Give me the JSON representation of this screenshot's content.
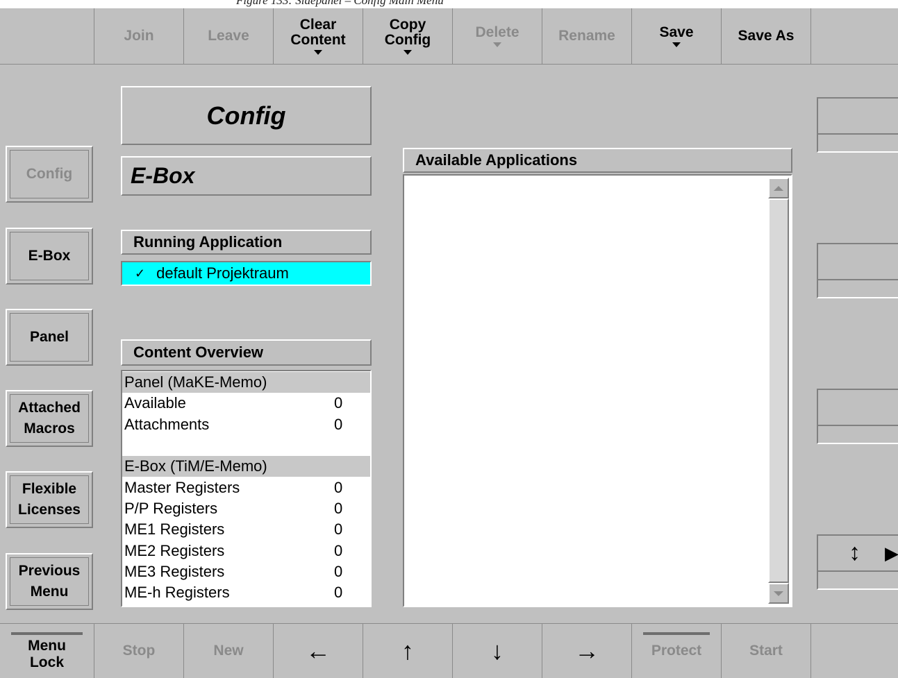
{
  "caption": "Figure 133: Sidepanel – Config Main Menu",
  "top_toolbar": [
    {
      "label": "",
      "enabled": false
    },
    {
      "label": "Join",
      "enabled": false
    },
    {
      "label": "Leave",
      "enabled": false
    },
    {
      "label": "Clear Content",
      "enabled": true,
      "dropdown": true
    },
    {
      "label": "Copy Config",
      "enabled": true,
      "dropdown": true
    },
    {
      "label": "Delete",
      "enabled": false,
      "dropdown": true
    },
    {
      "label": "Rename",
      "enabled": false
    },
    {
      "label": "Save",
      "enabled": true,
      "dropdown": true
    },
    {
      "label": "Save As",
      "enabled": true
    },
    {
      "label": "",
      "enabled": false
    }
  ],
  "sidebar": [
    {
      "label": "Config",
      "enabled": false
    },
    {
      "label": "E-Box",
      "enabled": true
    },
    {
      "label": "Panel",
      "enabled": true
    },
    {
      "label": "Attached Macros",
      "enabled": true
    },
    {
      "label": "Flexible Licenses",
      "enabled": true
    },
    {
      "label": "Previous Menu",
      "enabled": true
    }
  ],
  "main": {
    "title": "Config",
    "subtitle": "E-Box",
    "running_header": "Running Application",
    "running_item": "default Projektraum",
    "content_header": "Content Overview",
    "available_header": "Available Applications",
    "content_rows": [
      {
        "label": "Panel (MaKE-Memo)",
        "value": "",
        "section": true
      },
      {
        "label": "Available",
        "value": "0",
        "section": false
      },
      {
        "label": "Attachments",
        "value": "0",
        "section": false
      },
      {
        "label": "",
        "value": "",
        "section": false
      },
      {
        "label": "E-Box (TiM/E-Memo)",
        "value": "",
        "section": true
      },
      {
        "label": "Master Registers",
        "value": "0",
        "section": false
      },
      {
        "label": "P/P Registers",
        "value": "0",
        "section": false
      },
      {
        "label": "ME1 Registers",
        "value": "0",
        "section": false
      },
      {
        "label": "ME2 Registers",
        "value": "0",
        "section": false
      },
      {
        "label": "ME3 Registers",
        "value": "0",
        "section": false
      },
      {
        "label": "ME-h Registers",
        "value": "0",
        "section": false
      }
    ]
  },
  "bottom_toolbar": [
    {
      "label": "Menu Lock",
      "enabled": true,
      "indicator": true
    },
    {
      "label": "Stop",
      "enabled": false
    },
    {
      "label": "New",
      "enabled": false
    },
    {
      "label": "←",
      "enabled": true,
      "icon": "arrow-left-icon"
    },
    {
      "label": "↑",
      "enabled": true,
      "icon": "arrow-up-icon"
    },
    {
      "label": "↓",
      "enabled": true,
      "icon": "arrow-down-icon"
    },
    {
      "label": "→",
      "enabled": true,
      "icon": "arrow-right-icon"
    },
    {
      "label": "Protect",
      "enabled": false,
      "indicator": true
    },
    {
      "label": "Start",
      "enabled": false
    },
    {
      "label": "",
      "enabled": false
    }
  ],
  "right_panel": {
    "updown_icon": "↕",
    "right_icon": "▶"
  }
}
